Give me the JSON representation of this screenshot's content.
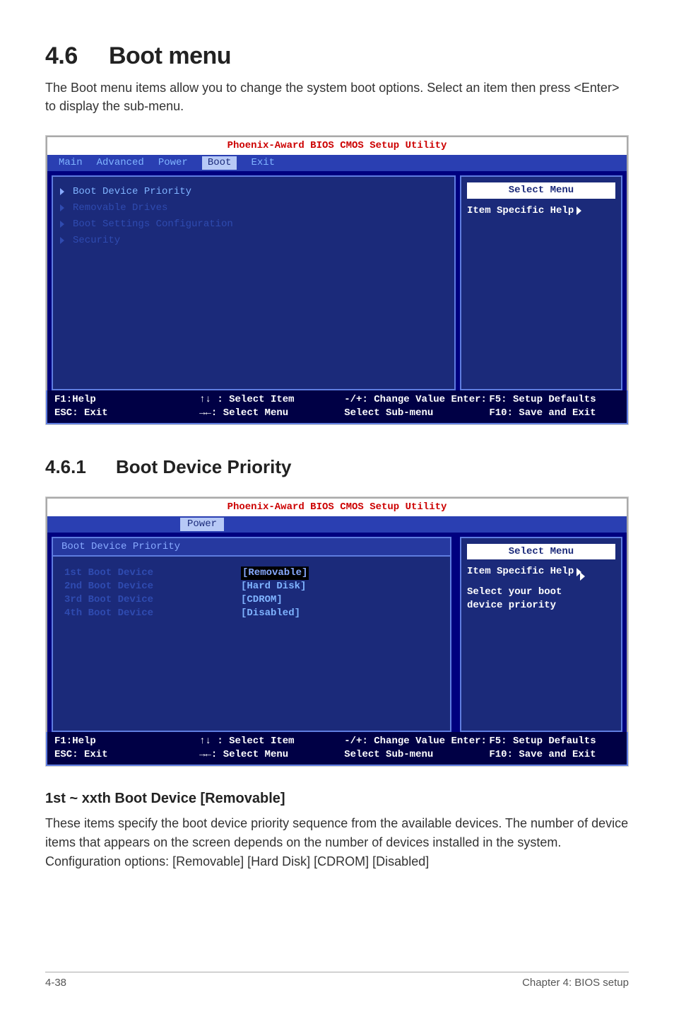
{
  "section": {
    "number": "4.6",
    "title": "Boot menu"
  },
  "intro": "The Boot menu items allow you to change the system boot options. Select an item then press <Enter> to display the sub-menu.",
  "bios1": {
    "title": "Phoenix-Award BIOS CMOS Setup Utility",
    "tabs": {
      "main": "Main",
      "advanced": "Advanced",
      "power": "Power",
      "boot": "Boot",
      "exit": "Exit"
    },
    "items": {
      "i0": "Boot Device Priority",
      "i1": "Removable Drives",
      "i2": "Boot Settings Configuration",
      "i3": "Security"
    },
    "right": {
      "select_menu": "Select Menu",
      "item_specific": "Item Specific Help"
    },
    "footer": {
      "c1a": "F1:Help",
      "c1b": "ESC: Exit",
      "c2a": "↑↓ : Select Item",
      "c2b": "→←: Select Menu",
      "c3a": "-/+: Change Value",
      "c3b": "Enter: Select Sub-menu",
      "c4a": "F5: Setup Defaults",
      "c4b": "F10: Save and Exit"
    }
  },
  "sub": {
    "number": "4.6.1",
    "title": "Boot Device Priority"
  },
  "bios2": {
    "title": "Phoenix-Award BIOS CMOS Setup Utility",
    "tab_power": "Power",
    "pane_title": "Boot Device Priority",
    "rows": {
      "r1n": "1st Boot Device",
      "r1v": "[Removable]",
      "r2n": "2nd Boot Device",
      "r2v": "[Hard Disk]",
      "r3n": "3rd Boot Device",
      "r3v": "[CDROM]",
      "r4n": "4th Boot Device",
      "r4v": "[Disabled]"
    },
    "right": {
      "select_menu": "Select Menu",
      "item_specific": "Item Specific Help",
      "extra1": "Select your boot",
      "extra2": "device priority"
    },
    "footer": {
      "c1a": "F1:Help",
      "c1b": "ESC: Exit",
      "c2a": "↑↓ : Select Item",
      "c2b": "→←: Select Menu",
      "c3a": "-/+: Change Value",
      "c3b": "Enter: Select Sub-menu",
      "c4a": "F5: Setup Defaults",
      "c4b": "F10: Save and Exit"
    }
  },
  "minor": {
    "heading": "1st ~ xxth Boot Device [Removable]",
    "p1": "These items specify the boot device priority sequence from the available devices. The number of device items that appears on the screen depends on the number of devices installed in the system.",
    "p2": "Configuration options: [Removable] [Hard Disk] [CDROM] [Disabled]"
  },
  "footer": {
    "left": "4-38",
    "right": "Chapter 4: BIOS setup"
  }
}
